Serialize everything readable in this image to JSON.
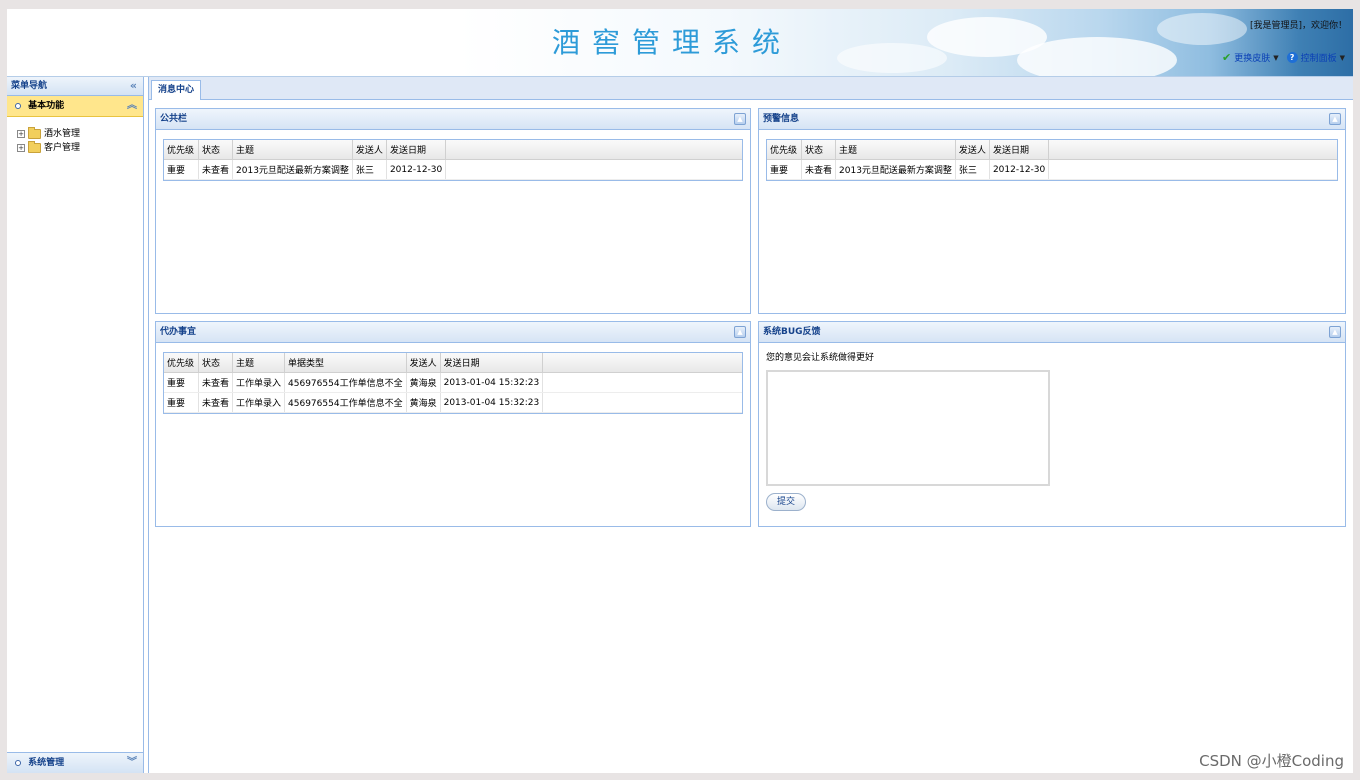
{
  "header": {
    "title": "酒窖管理系统",
    "welcome": "[我是管理员]，欢迎你！",
    "skin_label": "更换皮肤",
    "panel_label": "控制面板"
  },
  "sidebar": {
    "title": "菜单导航",
    "group_active": "基本功能",
    "tree_items": [
      "酒水管理",
      "客户管理"
    ],
    "group_bottom": "系统管理"
  },
  "tabs": [
    "消息中心"
  ],
  "panels": {
    "public": {
      "title": "公共栏",
      "columns": [
        "优先级",
        "状态",
        "主题",
        "发送人",
        "发送日期"
      ],
      "rows": [
        [
          "重要",
          "未查看",
          "2013元旦配送最新方案调整",
          "张三",
          "2012-12-30"
        ]
      ]
    },
    "warning": {
      "title": "预警信息",
      "columns": [
        "优先级",
        "状态",
        "主题",
        "发送人",
        "发送日期"
      ],
      "rows": [
        [
          "重要",
          "未查看",
          "2013元旦配送最新方案调整",
          "张三",
          "2012-12-30"
        ]
      ]
    },
    "todo": {
      "title": "代办事宜",
      "columns": [
        "优先级",
        "状态",
        "主题",
        "单据类型",
        "发送人",
        "发送日期"
      ],
      "rows": [
        [
          "重要",
          "未查看",
          "工作单录入",
          "456976554工作单信息不全",
          "黄海泉",
          "2013-01-04 15:32:23"
        ],
        [
          "重要",
          "未查看",
          "工作单录入",
          "456976554工作单信息不全",
          "黄海泉",
          "2013-01-04 15:32:23"
        ]
      ]
    },
    "feedback": {
      "title": "系统BUG反馈",
      "prompt": "您的意见会让系统做得更好",
      "submit_label": "提交"
    }
  },
  "watermark": "CSDN @小橙Coding"
}
